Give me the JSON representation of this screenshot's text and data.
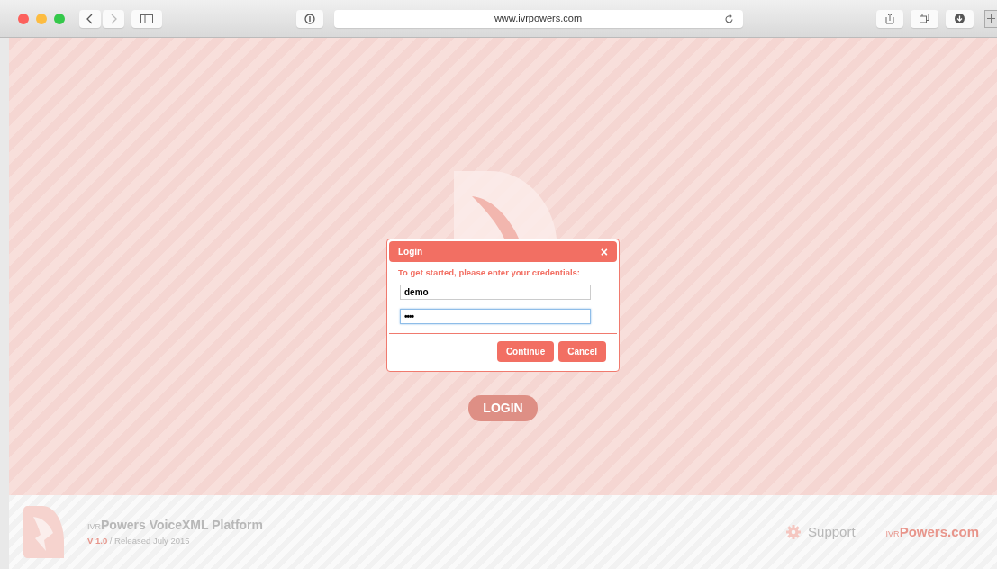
{
  "browser": {
    "url": "www.ivrpowers.com"
  },
  "dialog": {
    "title": "Login",
    "close": "×",
    "prompt": "To get started, please enter your credentials:",
    "fields": [
      {
        "kind": "text",
        "value": "demo",
        "focused": false
      },
      {
        "kind": "password",
        "value": "••••",
        "focused": true
      }
    ],
    "buttons": [
      "Continue",
      "Cancel"
    ]
  },
  "login_label": "LOGIN",
  "footer": {
    "brand_prefix": "IVR",
    "brand_title": "Powers VoiceXML Platform",
    "version": "V 1.0",
    "release": "/ Released July 2015",
    "support": "Support",
    "site_prefix": "IVR",
    "site_name": "Powers.com"
  }
}
